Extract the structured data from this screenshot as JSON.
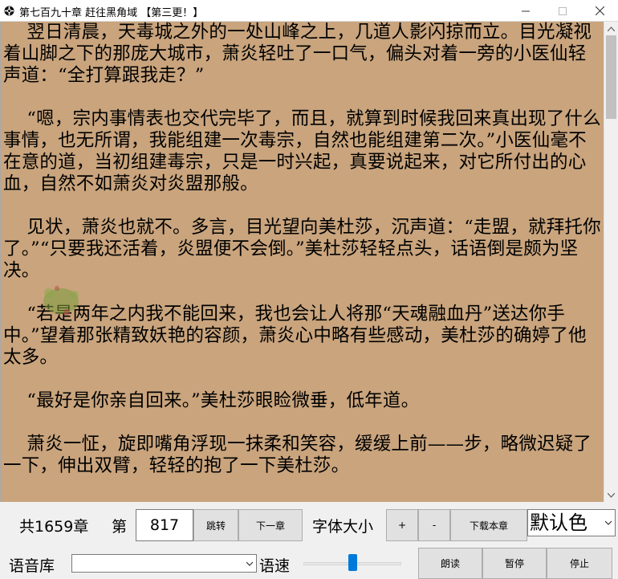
{
  "window": {
    "title": "第七百九十章 赶往黑角域 【第三更！】"
  },
  "reader": {
    "paragraphs": [
      "    翌日清晨，天毒城之外的一处山峰之上，几道人影闪掠而立。目光凝视着山脚之下的那庞大城市，萧炎轻吐了一口气，偏头对着一旁的小医仙轻声道：“全打算跟我走？”",
      "    “嗯，宗内事情表也交代完毕了，而且，就算到时候我回来真出现了什么事情，也无所谓，我能组建一次毒宗，自然也能组建第二次。”小医仙毫不在意的道，当初组建毒宗，只是一时兴起，真要说起来，对它所付出的心血，自然不如萧炎对炎盟那般。",
      "    见状，萧炎也就不。多言，目光望向美杜莎，沉声道：“走盟，就拜托你了。”“只要我还活着，炎盟便不会倒。”美杜莎轻轻点头，话语倒是颇为坚决。",
      "    “若是两年之内我不能回来，我也会让人将那“天魂融血丹”送达你手中。”望着那张精致妖艳的容颜，萧炎心中略有些感动，美杜莎的确婷了他太多。",
      "    “最好是你亲自回来。”美杜莎眼睑微垂，低年道。",
      "    萧炎一怔，旋即嘴角浮现一抹柔和笑容，缓缓上前——步，略微迟疑了一下，伸出双臂，轻轻的抱了一下美杜莎。"
    ]
  },
  "toolbar": {
    "total_chapters": "共1659章",
    "chapter_label": "第",
    "chapter_value": "817",
    "jump_button": "跳转",
    "next_chapter_button": "下一章",
    "font_size_label": "字体大小",
    "font_plus_button": "+",
    "font_minus_button": "-",
    "download_button": "下载本章",
    "color_select_value": "默认色"
  },
  "speech": {
    "voice_library_label": "语音库",
    "voice_select_value": "",
    "speed_label": "语速",
    "speed_level": 0.5,
    "read_button": "朗读",
    "pause_button": "暂停",
    "stop_button": "停止"
  },
  "colors": {
    "reader_background": "#c9a47d",
    "slider_accent": "#007ad9"
  }
}
